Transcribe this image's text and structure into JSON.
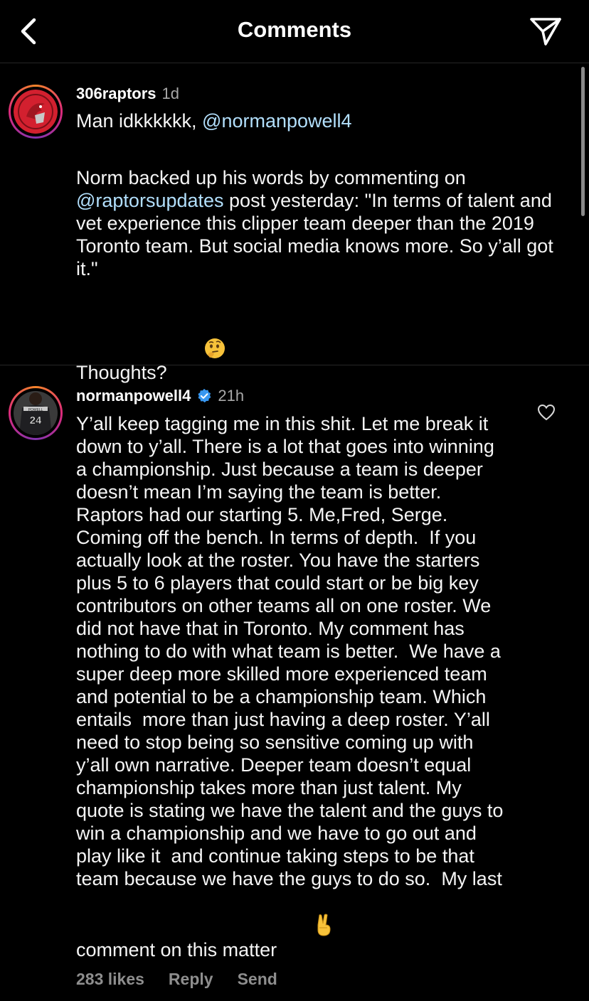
{
  "header": {
    "title": "Comments",
    "back_icon": "chevron-left-icon",
    "send_icon": "paper-plane-icon"
  },
  "caption": {
    "username": "306raptors",
    "time": "1d",
    "line1_prefix": "Man idkkkkkk, ",
    "line1_mention": "@normanpowell4",
    "para_prefix": "Norm backed up his words by commenting on ",
    "para_mention": "@raptorsupdates",
    "para_rest": " post yesterday: \"In terms of talent and vet experience this clipper team deeper than the 2019 Toronto team. But social media knows more. So y’all got it.\"",
    "thoughts": "Thoughts?",
    "thoughts_emoji": "thinking-face"
  },
  "comment": {
    "username": "normanpowell4",
    "verified": true,
    "time": "21h",
    "text": "Y’all keep tagging me in this shit. Let me break it down to y’all. There is a lot that goes into winning a championship. Just because a team is deeper doesn’t mean I’m saying the team is better.  Raptors had our starting 5. Me,Fred, Serge. Coming off the bench. In terms of depth.  If you actually look at the roster. You have the starters plus 5 to 6 players that could start or be big key contributors on other teams all on one roster. We did not have that in Toronto. My comment has nothing to do with what team is better.  We have a super deep more skilled more experienced team and potential to be a championship team. Which entails  more than just having a deep roster. Y’all need to stop being so sensitive coming up with y’all own narrative. Deeper team doesn’t equal championship takes more than just talent. My quote is stating we have the talent and the guys to win a championship and we have to go out and play like it  and continue taking steps to be that team because we have the guys to do so.  My last comment on this matter",
    "end_emoji": "victory-hand",
    "jersey_number": "24",
    "jersey_name": "POWELL",
    "likes": "283 likes",
    "reply_label": "Reply",
    "send_label": "Send"
  },
  "colors": {
    "background": "#000000",
    "mention": "#b2dffc",
    "secondary_text": "#a8a8a8",
    "verified_blue": "#3897f0"
  }
}
